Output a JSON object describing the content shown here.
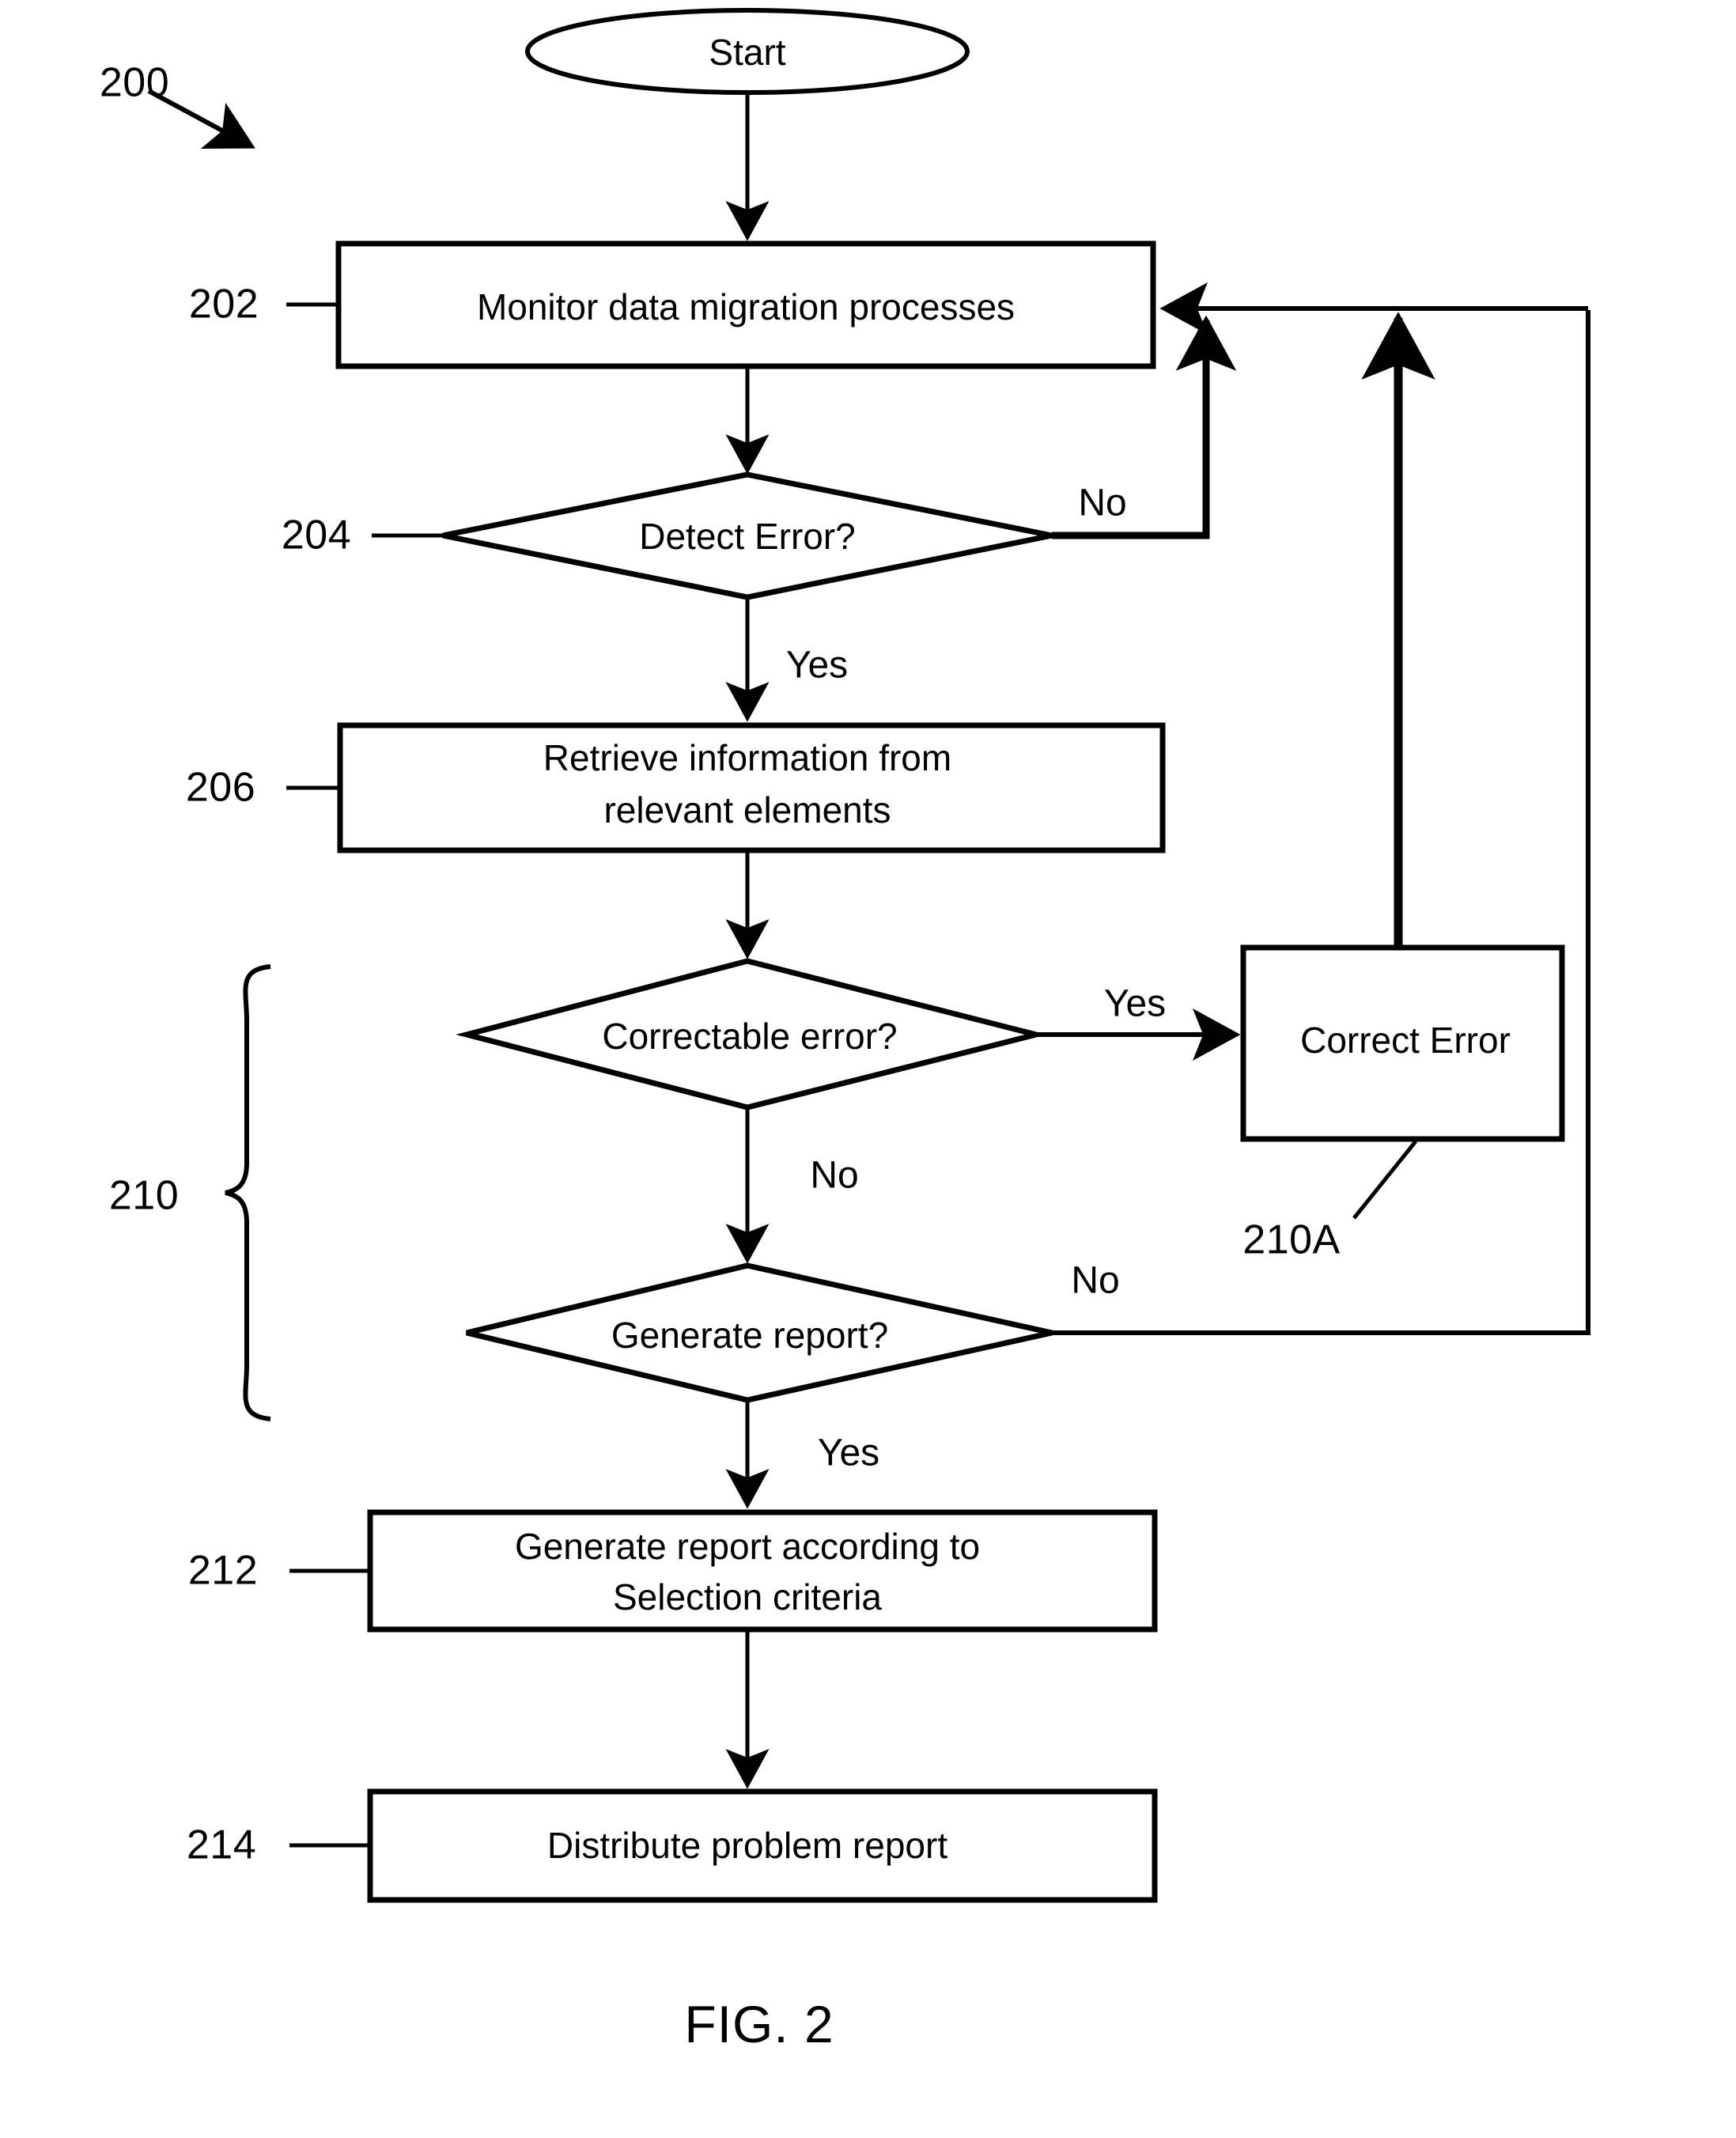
{
  "figure": {
    "caption": "FIG. 2",
    "diagram_ref": "200",
    "type": "flowchart"
  },
  "nodes": {
    "start": {
      "label": "Start",
      "shape": "ellipse",
      "ref": ""
    },
    "monitor": {
      "label": "Monitor data migration processes",
      "shape": "rect",
      "ref": "202"
    },
    "detect_error": {
      "label": "Detect Error?",
      "shape": "diamond",
      "ref": "204"
    },
    "retrieve": {
      "line1": "Retrieve information from",
      "line2": "relevant elements",
      "shape": "rect",
      "ref": "206"
    },
    "correctable": {
      "label": "Correctable error?",
      "shape": "diamond",
      "ref": ""
    },
    "correct_error": {
      "label": "Correct Error",
      "shape": "rect",
      "ref": "210A"
    },
    "generate_q": {
      "label": "Generate report?",
      "shape": "diamond",
      "ref": ""
    },
    "generate_report": {
      "line1": "Generate report according to",
      "line2": "Selection criteria",
      "shape": "rect",
      "ref": "212"
    },
    "distribute": {
      "label": "Distribute problem report",
      "shape": "rect",
      "ref": "214"
    }
  },
  "group": {
    "brace_ref": "210"
  },
  "branch_labels": {
    "detect_no": "No",
    "detect_yes": "Yes",
    "correctable_yes": "Yes",
    "correctable_no": "No",
    "generate_no": "No",
    "generate_yes": "Yes"
  },
  "style": {
    "stroke": "#000000",
    "fill": "#ffffff",
    "background": "#ffffff"
  }
}
